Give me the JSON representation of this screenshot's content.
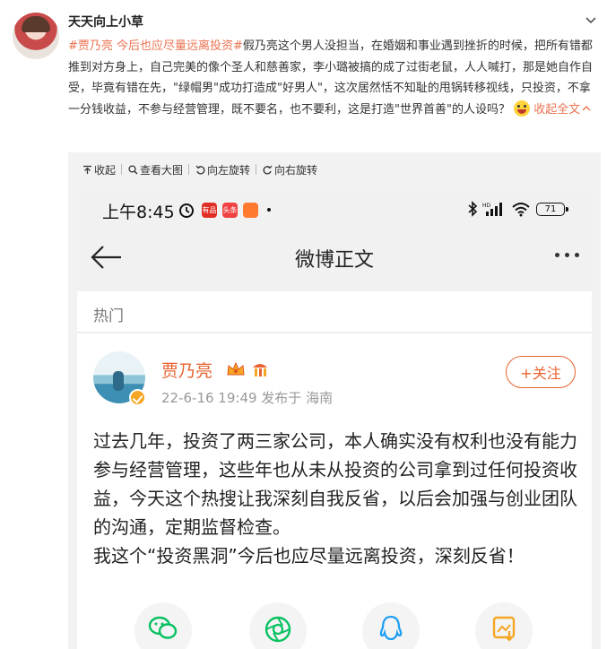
{
  "post": {
    "username": "天天向上小草",
    "topic": "#贾乃亮 今后也应尽量远离投资#",
    "text": "假乃亮这个男人没担当，在婚姻和事业遇到挫折的时候，把所有错都推到对方身上，自己完美的像个圣人和慈善家，李小璐被搞的成了过街老鼠，人人喊打，那是她自作自受，毕竟有错在先，\"绿帽男\"成功打造成\"好男人\"，这次居然恬不知耻的甩锅转移视线，只投资，不拿一分钱收益，不参与经营管理，既不要名，也不要利，这是打造\"世界首善\"的人设吗？",
    "fold_label": "收起全文"
  },
  "toolbar": {
    "collapse": "收起",
    "view_large": "查看大图",
    "rotate_left": "向左旋转",
    "rotate_right": "向右旋转"
  },
  "phone": {
    "status_time": "上午8:45",
    "battery": "71",
    "app_badges": [
      {
        "text": "有品",
        "color": "#e02e24"
      },
      {
        "text": "头条",
        "color": "#f04142"
      },
      {
        "text": "",
        "color": "#ff7a2f"
      }
    ],
    "nav_title": "微博正文",
    "hot_label": "热门",
    "weibo": {
      "name": "贾乃亮",
      "meta": "22-6-16 19:49  发布于 海南",
      "follow_label": "+关注",
      "body_1": "过去几年，投资了两三家公司，本人确实没有权利也没有能力参与经营管理，这些年也从未从投资的公司拿到过任何投资收益，今天这个热搜让我深刻自我反省，以后会加强与创业团队的沟通，定期监督检查。",
      "body_2": "我这个“投资黑洞”今后也应尽量远离投资，深刻反省！"
    },
    "share_icons": [
      "wechat-icon",
      "moments-icon",
      "qq-icon",
      "save-image-icon"
    ]
  },
  "colors": {
    "topic": "#eb7350",
    "weibo_orange": "#e8622f",
    "wechat_green": "#07c160",
    "qq_blue": "#1e9ff2"
  }
}
